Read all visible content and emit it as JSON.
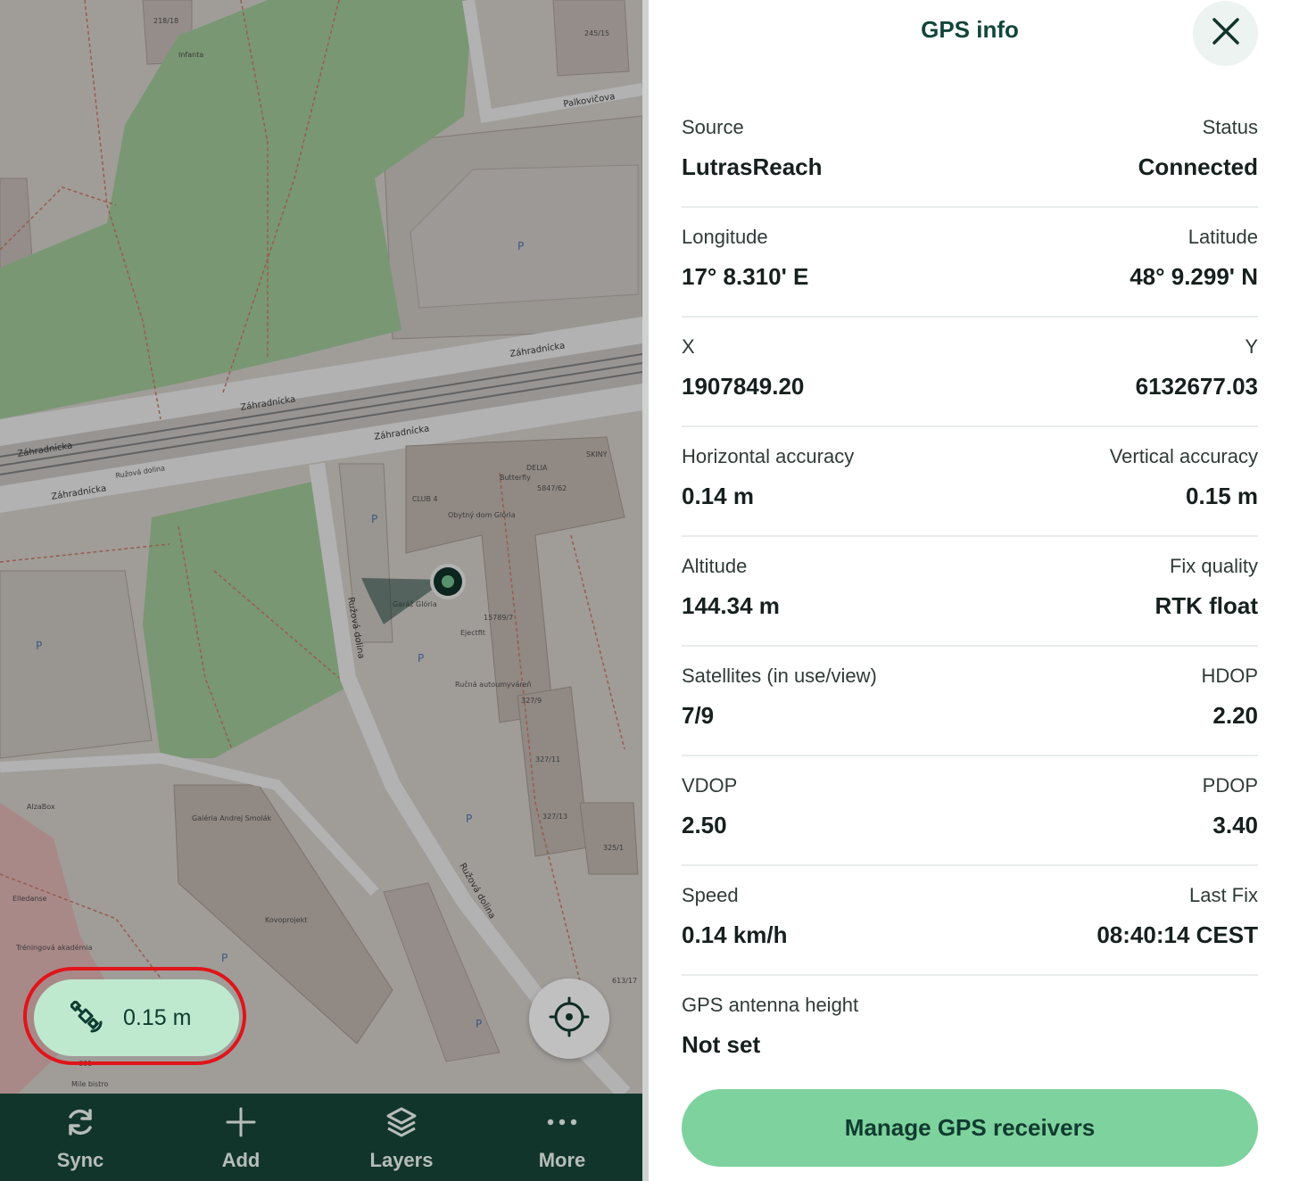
{
  "map": {
    "labels": {
      "street_zahradnicka": "Záhradnícka",
      "street_zahradnicka_arrow": "Záhradnícka",
      "street_ruzova_dolina": "Ružová dolina",
      "street_ruzova_dolina_small": "Ružová dolina",
      "street_palkovicova": "Palkovičova",
      "poi_club4": "CLUB 4",
      "poi_obytny_dom": "Obytný dom Glória",
      "poi_garaz_gloria": "Garáž Glória",
      "poi_ejectfit": "Ejectfit",
      "poi_rucna_autoumyvaren": "Ručná autoumyváreň",
      "poi_galeria": "Galéria Andrej Smolák",
      "poi_kovoprojekt": "Kovoprojekt",
      "poi_alzabox": "AlzaBox",
      "poi_delia": "DELIA",
      "poi_butterfly": "Butterfly",
      "poi_skiny": "SKINY",
      "poi_infanta": "Infanta",
      "poi_treningova": "Tréningová akadémia",
      "poi_elledanse": "Elledanse",
      "poi_milebistro": "Mile bistro",
      "house_21818": "218/18",
      "house_24515": "245/15",
      "house_584762": "5847/62",
      "house_157897": "15789/7",
      "house_3279": "327/9",
      "house_32711": "327/11",
      "house_32713": "327/13",
      "house_3251": "325/1",
      "house_61317": "613/17",
      "house_601": "601"
    }
  },
  "accuracy_chip": {
    "value": "0.15 m",
    "icon": "satellite-icon"
  },
  "nav": [
    {
      "label": "Sync",
      "icon": "sync-icon"
    },
    {
      "label": "Add",
      "icon": "plus-icon"
    },
    {
      "label": "Layers",
      "icon": "layers-icon"
    },
    {
      "label": "More",
      "icon": "more-dots-icon"
    }
  ],
  "panel": {
    "title": "GPS info",
    "rows": [
      {
        "left_label": "Source",
        "left_value": "LutrasReach",
        "right_label": "Status",
        "right_value": "Connected"
      },
      {
        "left_label": "Longitude",
        "left_value": "17° 8.310' E",
        "right_label": "Latitude",
        "right_value": "48° 9.299' N"
      },
      {
        "left_label": "X",
        "left_value": "1907849.20",
        "right_label": "Y",
        "right_value": "6132677.03"
      },
      {
        "left_label": "Horizontal accuracy",
        "left_value": "0.14 m",
        "right_label": "Vertical accuracy",
        "right_value": "0.15 m"
      },
      {
        "left_label": "Altitude",
        "left_value": "144.34 m",
        "right_label": "Fix quality",
        "right_value": "RTK float"
      },
      {
        "left_label": "Satellites (in use/view)",
        "left_value": "7/9",
        "right_label": "HDOP",
        "right_value": "2.20"
      },
      {
        "left_label": "VDOP",
        "left_value": "2.50",
        "right_label": "PDOP",
        "right_value": "3.40"
      },
      {
        "left_label": "Speed",
        "left_value": "0.14 km/h",
        "right_label": "Last Fix",
        "right_value": "08:40:14 CEST"
      },
      {
        "left_label": "GPS antenna height",
        "left_value": "Not set"
      }
    ],
    "manage_button": "Manage GPS receivers"
  },
  "colors": {
    "accent_green": "#7ed29d",
    "chip_green": "#bfe9cf",
    "dark_green": "#12352b",
    "highlight_red": "#e0141b"
  }
}
